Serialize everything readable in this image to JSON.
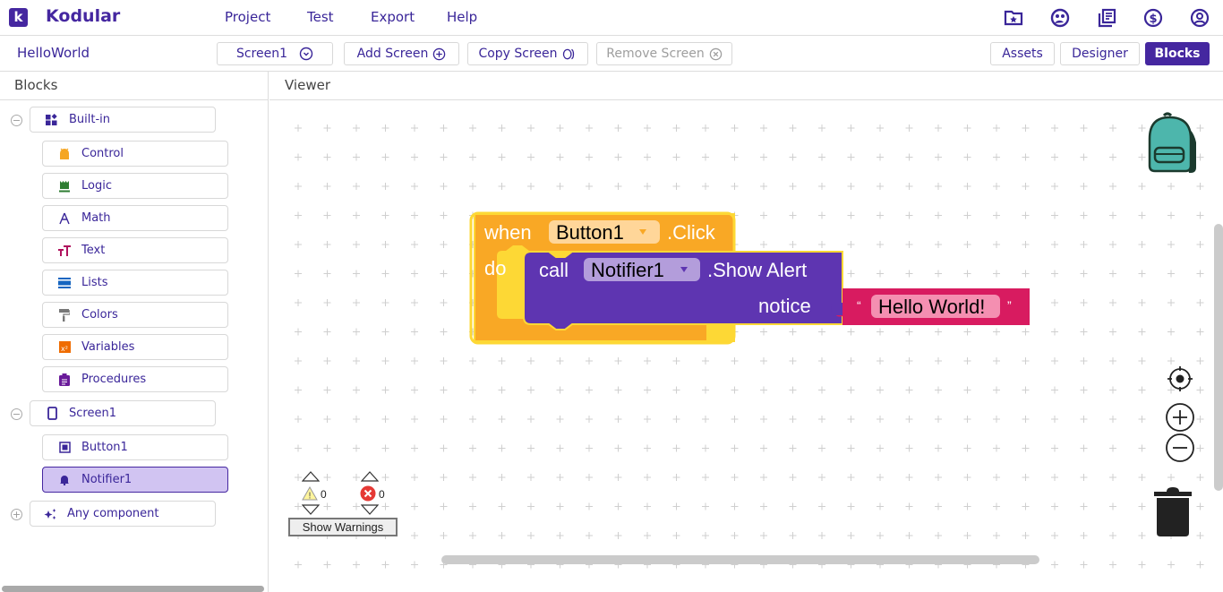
{
  "app": {
    "brand": "Kodular",
    "logo_letter": "k",
    "menu": [
      "Project",
      "Test",
      "Export",
      "Help"
    ],
    "top_icons": [
      "folder-star-icon",
      "community-icon",
      "docs-icon",
      "dollar-icon",
      "account-icon"
    ]
  },
  "toolbar": {
    "project_name": "HelloWorld",
    "screen_select": "Screen1",
    "add_screen": "Add Screen",
    "copy_screen": "Copy Screen",
    "remove_screen": "Remove Screen",
    "assets": "Assets",
    "designer": "Designer",
    "blocks": "Blocks",
    "active_view": "Blocks"
  },
  "sidebar": {
    "title": "Blocks",
    "builtin": {
      "label": "Built-in",
      "toggle": "−",
      "items": [
        {
          "label": "Control",
          "icon": "control-icon",
          "color": "#f5a623"
        },
        {
          "label": "Logic",
          "icon": "logic-icon",
          "color": "#2e7d32"
        },
        {
          "label": "Math",
          "icon": "math-icon",
          "color": "#3a2699"
        },
        {
          "label": "Text",
          "icon": "text-icon",
          "color": "#b0125e"
        },
        {
          "label": "Lists",
          "icon": "lists-icon",
          "color": "#1565c0"
        },
        {
          "label": "Colors",
          "icon": "colors-icon",
          "color": "#777777"
        },
        {
          "label": "Variables",
          "icon": "variables-icon",
          "color": "#ef6c00"
        },
        {
          "label": "Procedures",
          "icon": "procedures-icon",
          "color": "#6a1b9a"
        }
      ]
    },
    "screen": {
      "label": "Screen1",
      "toggle": "−",
      "items": [
        {
          "label": "Button1",
          "icon": "button-icon",
          "selected": false
        },
        {
          "label": "Notifier1",
          "icon": "bell-icon",
          "selected": true
        }
      ]
    },
    "any_component": {
      "label": "Any component",
      "toggle": "+"
    }
  },
  "viewer": {
    "title": "Viewer",
    "event_block": {
      "keyword": "when",
      "component": "Button1",
      "event": ".Click",
      "do_label": "do",
      "color": "#f9a825"
    },
    "call_block": {
      "keyword": "call",
      "component": "Notifier1",
      "method": ".Show Alert",
      "param": "notice",
      "color": "#5e35b1"
    },
    "text_block": {
      "open_quote": "“",
      "value": "Hello World!",
      "close_quote": "”",
      "color": "#d81b60"
    },
    "warnings": {
      "count": "0",
      "errors": "0",
      "button": "Show Warnings"
    }
  }
}
